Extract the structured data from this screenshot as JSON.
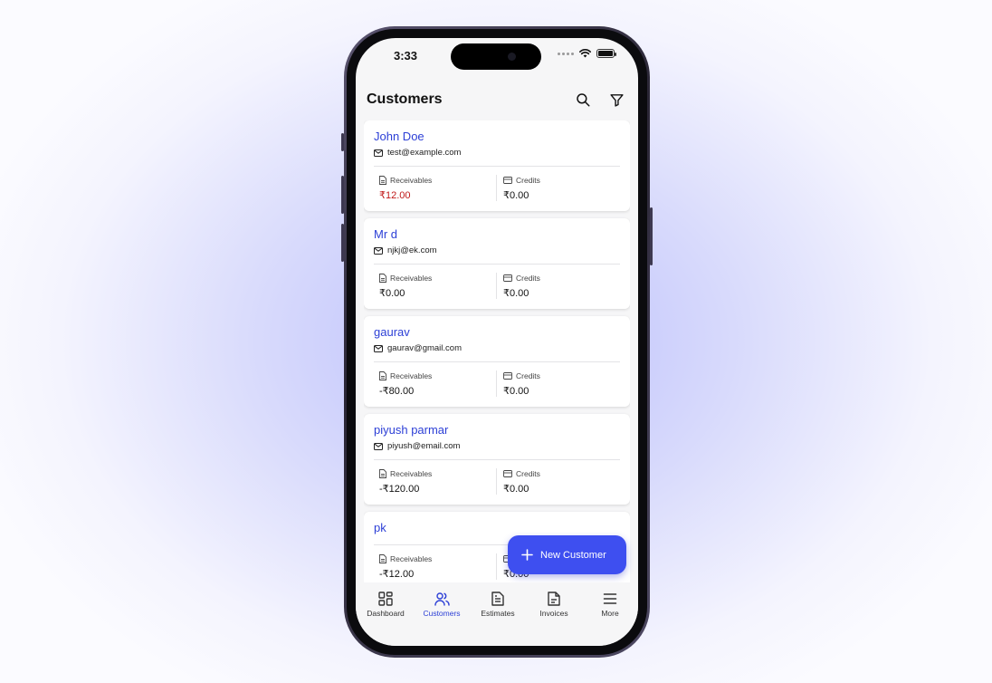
{
  "status": {
    "time": "3:33"
  },
  "header": {
    "title": "Customers",
    "search_icon": "search-icon",
    "filter_icon": "filter-icon"
  },
  "labels": {
    "receivables": "Receivables",
    "credits": "Credits"
  },
  "customers": [
    {
      "name": "John Doe",
      "email": "test@example.com",
      "receivables": "₹12.00",
      "credits": "₹0.00"
    },
    {
      "name": "Mr d",
      "email": "njkj@ek.com",
      "receivables": "₹0.00",
      "credits": "₹0.00"
    },
    {
      "name": "gaurav",
      "email": "gaurav@gmail.com",
      "receivables": "-₹80.00",
      "credits": "₹0.00"
    },
    {
      "name": "piyush parmar",
      "email": "piyush@email.com",
      "receivables": "-₹120.00",
      "credits": "₹0.00"
    },
    {
      "name": "pk",
      "email": "",
      "receivables": "-₹12.00",
      "credits": "₹0.00"
    }
  ],
  "fab": {
    "label": "New Customer"
  },
  "tabs": [
    {
      "label": "Dashboard",
      "icon": "grid-icon"
    },
    {
      "label": "Customers",
      "icon": "users-icon"
    },
    {
      "label": "Estimates",
      "icon": "document-icon"
    },
    {
      "label": "Invoices",
      "icon": "invoice-icon"
    },
    {
      "label": "More",
      "icon": "menu-icon"
    }
  ],
  "colors": {
    "accent": "#3e4ff0",
    "link": "#2c3fd6",
    "negative_receivable": "#c01818"
  }
}
